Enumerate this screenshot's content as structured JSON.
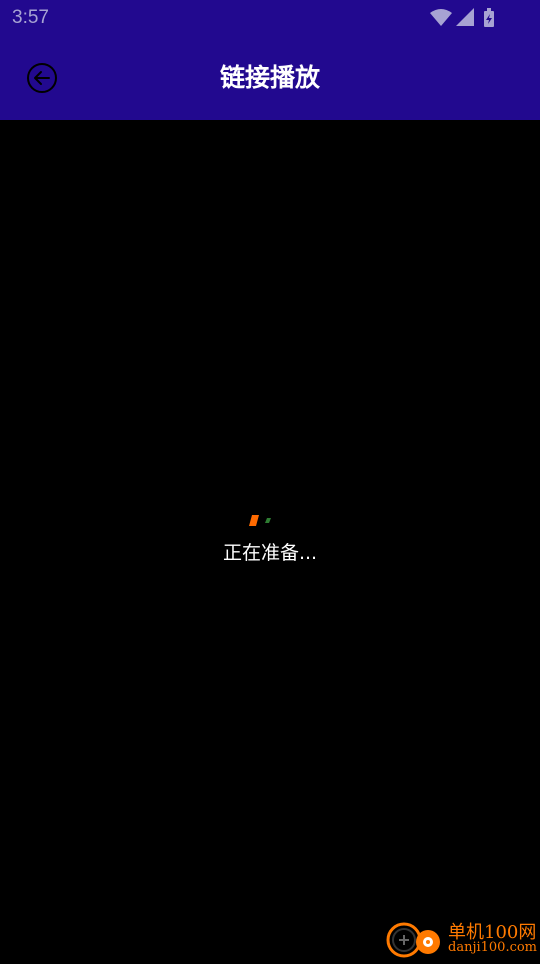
{
  "status_bar": {
    "time": "3:57",
    "icons": [
      "wifi-icon",
      "cellular-signal-icon",
      "battery-charging-icon"
    ]
  },
  "app_bar": {
    "title": "链接播放",
    "back_icon": "back-arrow-circle-icon"
  },
  "player": {
    "loading_text": "正在准备...",
    "spinner_colors": [
      "#ff6a00",
      "#2e7d32"
    ]
  },
  "watermark": {
    "name": "单机100网",
    "url": "danji100.com",
    "color": "#ff7a00"
  },
  "colors": {
    "primary": "#22098f",
    "background": "#000000",
    "text": "#ffffff"
  }
}
